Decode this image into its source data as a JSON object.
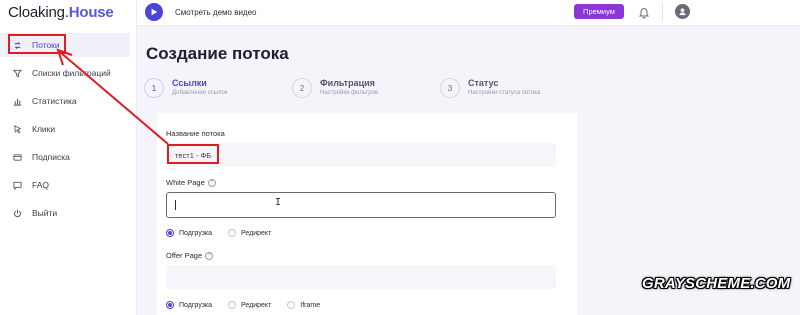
{
  "logo": {
    "part1": "Cloaking.",
    "part2": "House"
  },
  "sidebar": {
    "items": [
      {
        "label": "Потоки",
        "icon": "refresh-icon"
      },
      {
        "label": "Списки фильтраций",
        "icon": "filter-icon"
      },
      {
        "label": "Статистика",
        "icon": "bar-chart-icon"
      },
      {
        "label": "Клики",
        "icon": "cursor-click-icon"
      },
      {
        "label": "Подписка",
        "icon": "card-icon"
      },
      {
        "label": "FAQ",
        "icon": "chat-icon"
      },
      {
        "label": "Выйти",
        "icon": "power-icon"
      }
    ]
  },
  "topbar": {
    "demo_label": "Смотреть демо видео",
    "premium_label": "Премиум"
  },
  "main": {
    "title": "Создание потока",
    "steps": [
      {
        "num": "1",
        "title": "Ссылки",
        "sub": "Добавление ссылок"
      },
      {
        "num": "2",
        "title": "Фильтрация",
        "sub": "Настройки фильтров"
      },
      {
        "num": "3",
        "title": "Статус",
        "sub": "Настройки статуса потока"
      }
    ],
    "form": {
      "name_label": "Название потока",
      "name_value": "тест1 - ФБ",
      "white_label": "White Page",
      "white_value": "",
      "offer_label": "Offer Page",
      "offer_value": "",
      "help_glyph": "?",
      "white_options": [
        {
          "label": "Подгрузка",
          "selected": true
        },
        {
          "label": "Редирект",
          "selected": false
        }
      ],
      "offer_options": [
        {
          "label": "Подгрузка",
          "selected": true
        },
        {
          "label": "Редирект",
          "selected": false
        },
        {
          "label": "Iframe",
          "selected": false
        }
      ]
    }
  },
  "watermark": "GRAYSCHEME.COM",
  "colors": {
    "accent": "#4b44d8",
    "premium": "#8c35d8",
    "annotation": "#e01b24"
  }
}
